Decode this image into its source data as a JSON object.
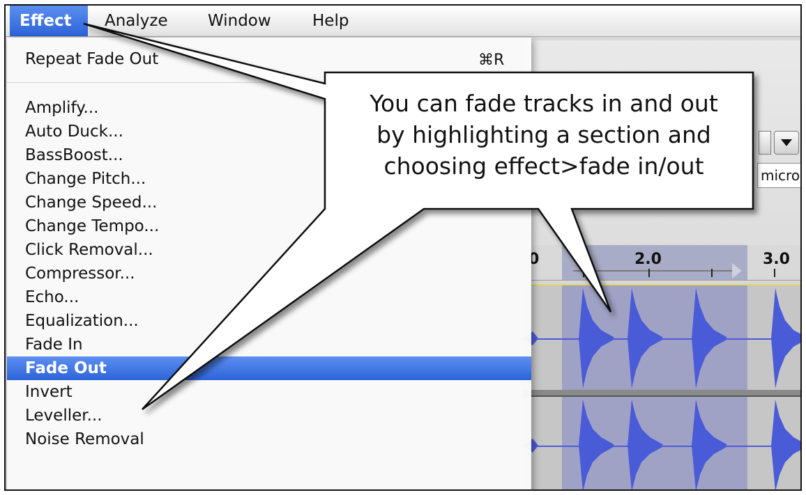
{
  "menubar": {
    "items": [
      "Effect",
      "Analyze",
      "Window",
      "Help"
    ]
  },
  "effect_menu": {
    "repeat_label": "Repeat Fade Out",
    "repeat_shortcut": "⌘R",
    "items": [
      "Amplify...",
      "Auto Duck...",
      "BassBoost...",
      "Change Pitch...",
      "Change Speed...",
      "Change Tempo...",
      "Click Removal...",
      "Compressor...",
      "Echo...",
      "Equalization...",
      "Fade In",
      "Fade Out",
      "Invert",
      "Leveller...",
      "Noise Removal"
    ],
    "selected_item": "Fade Out"
  },
  "background_app": {
    "ruler_labels": [
      "0",
      "2.0",
      "3.0"
    ],
    "input_device_partial": "micro",
    "dropdown_icon": "chevron-down-icon"
  },
  "callout": {
    "lines": [
      "You can fade tracks in and out",
      "by highlighting a section and",
      "choosing effect>fade in/out"
    ]
  },
  "colors": {
    "selection_blue": "#2f66da",
    "waveform_blue": "#4a5bd8",
    "selected_region": "#9fa1c5"
  }
}
